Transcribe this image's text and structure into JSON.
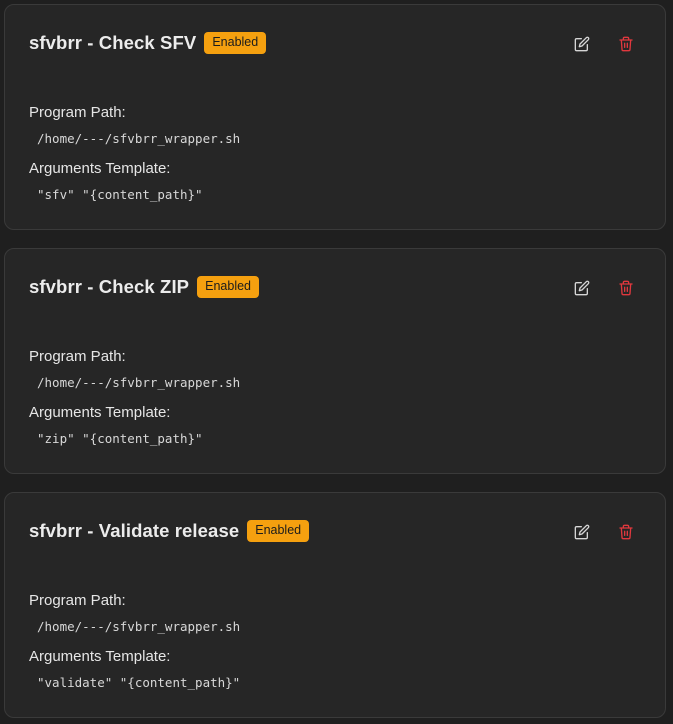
{
  "actions": [
    {
      "name": "sfvbrr - Check SFV",
      "status": "Enabled",
      "program_path_label": "Program Path:",
      "program_path": "/home/---/sfvbrr_wrapper.sh",
      "args_label": "Arguments Template:",
      "args": "\"sfv\" \"{content_path}\""
    },
    {
      "name": "sfvbrr - Check ZIP",
      "status": "Enabled",
      "program_path_label": "Program Path:",
      "program_path": "/home/---/sfvbrr_wrapper.sh",
      "args_label": "Arguments Template:",
      "args": "\"zip\" \"{content_path}\""
    },
    {
      "name": "sfvbrr - Validate release",
      "status": "Enabled",
      "program_path_label": "Program Path:",
      "program_path": "/home/---/sfvbrr_wrapper.sh",
      "args_label": "Arguments Template:",
      "args": "\"validate\" \"{content_path}\""
    }
  ],
  "icons": {
    "edit": "edit-icon",
    "delete": "trash-icon"
  },
  "colors": {
    "background": "#1f1f1f",
    "card": "#262626",
    "card_border": "#3a3a3a",
    "badge_enabled": "#f5a00f",
    "delete_icon": "#e0383e",
    "edit_icon": "#d6d6d6"
  }
}
